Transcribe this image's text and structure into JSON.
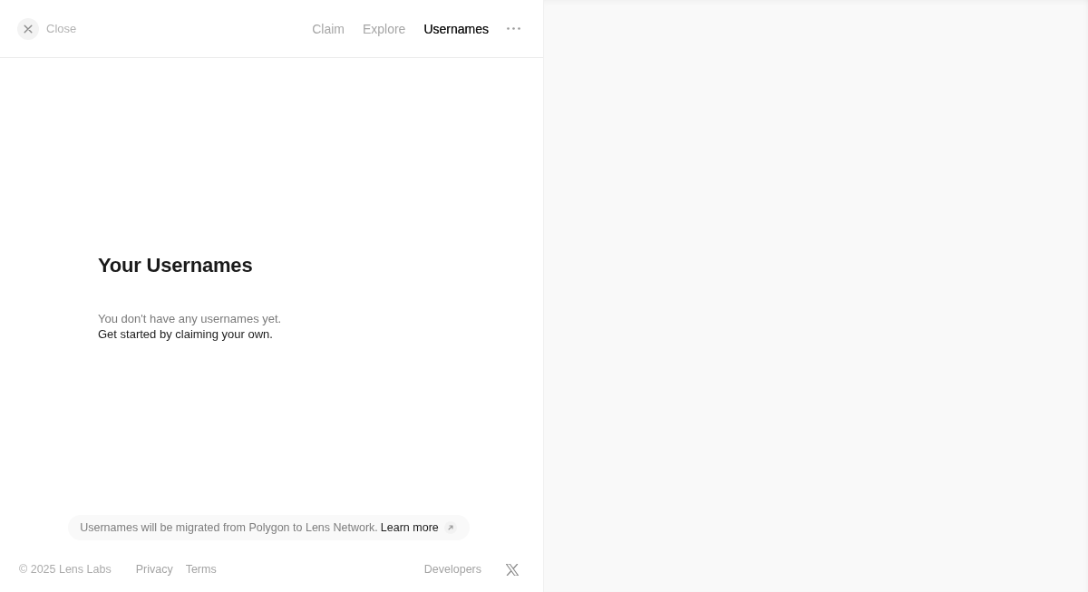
{
  "header": {
    "close": {
      "label": "Close"
    },
    "nav": [
      {
        "label": "Claim",
        "selected": false
      },
      {
        "label": "Explore",
        "selected": false
      },
      {
        "label": "Usernames",
        "selected": true
      }
    ]
  },
  "main": {
    "title": "Your Usernames",
    "lines": [
      {
        "text": "You don't have any usernames yet.",
        "kind": "muted"
      },
      {
        "text": "Get started by claiming your own.",
        "kind": "strong"
      }
    ]
  },
  "notice": {
    "text": "Usernames will be migrated from Polygon to Lens Network.",
    "link": "Learn more"
  },
  "footer": {
    "copyright": "© 2025 Lens Labs",
    "links": [
      "Privacy",
      "Terms"
    ],
    "right_links": [
      "Developers"
    ]
  }
}
